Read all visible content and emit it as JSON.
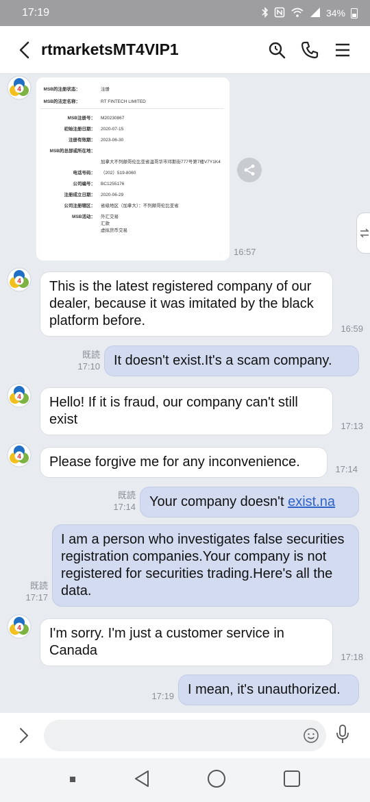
{
  "status_bar": {
    "time": "17:19",
    "battery": "34%",
    "icons": [
      "bluetooth-icon",
      "nfc-icon",
      "wifi-icon",
      "signal-icon",
      "battery-icon"
    ]
  },
  "header": {
    "title": "rtmarketsMT4VIP1",
    "icons": [
      "back-icon",
      "search-icon",
      "phone-icon",
      "menu-icon"
    ]
  },
  "document": {
    "top_rows": [
      {
        "label": "MSB的注册状态：",
        "value": "注册"
      },
      {
        "label": "MSB的法定名称：",
        "value": "RT FINTECH LIMITED"
      }
    ],
    "rows": [
      {
        "label": "MSB注册号：",
        "value": "M20230867"
      },
      {
        "label": "初始注册日期：",
        "value": "2020-07-15"
      },
      {
        "label": "注册有效期：",
        "value": "2023-06-30"
      },
      {
        "label": "MSB的总部或所在地：",
        "value": ""
      },
      {
        "label": "",
        "value": "加拿大不列颠哥伦比亚省温哥华市邓斯街777号第7楼V7Y1K4"
      },
      {
        "label": "电话号码：",
        "value": "（202）519-8060"
      },
      {
        "label": "公司编号：",
        "value": "BC1255176"
      },
      {
        "label": "注册成立日期：",
        "value": "2020-06-29"
      },
      {
        "label": "公司注册辖区：",
        "value": "省级地区（加拿大）：不列颠哥伦比亚省"
      },
      {
        "label": "MSB活动：",
        "value": "外汇交易"
      },
      {
        "label": "",
        "value": "汇款"
      },
      {
        "label": "",
        "value": "虚拟货币交易"
      }
    ],
    "time": "16:57"
  },
  "messages": [
    {
      "dir": "in",
      "text": "This is the latest registered company of our dealer, because it was imitated by the black platform before.",
      "time": "16:59"
    },
    {
      "dir": "out",
      "text": "It doesn't exist.It's a scam company.",
      "read": "既読",
      "time": "17:10"
    },
    {
      "dir": "in",
      "text": "Hello! If it is fraud, our company can't still exist",
      "time": "17:13"
    },
    {
      "dir": "in",
      "text": "Please forgive me for any inconvenience.",
      "time": "17:14"
    },
    {
      "dir": "out",
      "text": "Your company doesn't ",
      "link": "exist.na",
      "read": "既読",
      "time": "17:14"
    },
    {
      "dir": "out",
      "text": "I am a person who investigates false securities registration companies.Your company is not registered for securities trading.Here's all the data.",
      "read": "既読",
      "time": "17:17"
    },
    {
      "dir": "in",
      "text": "I'm sorry. I'm just a customer service in Canada",
      "time": "17:18"
    },
    {
      "dir": "out",
      "text": "I mean, it's unauthorized.",
      "time": "17:19"
    }
  ],
  "input": {
    "placeholder": "",
    "icons": [
      "expand-icon",
      "emoji-icon",
      "mic-icon"
    ]
  },
  "nav": {
    "icons": [
      "recent-apps-icon",
      "back-nav-icon",
      "home-icon",
      "overview-icon"
    ]
  },
  "colors": {
    "outgoing_bubble": "#d3dbf1",
    "incoming_bubble": "#ffffff",
    "chat_background": "#e8ecf1",
    "link": "#2d62c9",
    "status_bar": "#9e9ea1"
  }
}
